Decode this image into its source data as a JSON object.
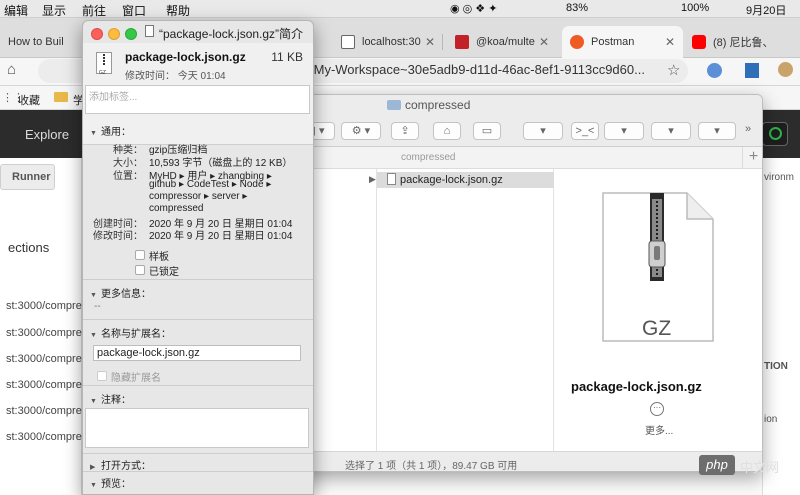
{
  "menubar": {
    "items": [
      "编辑",
      "显示",
      "前往",
      "窗口",
      "帮助"
    ],
    "status": {
      "battery_left": "83%",
      "battery_right": "100%",
      "date": "9月20日"
    }
  },
  "chrome": {
    "tabs": [
      {
        "label": "How to Buil"
      },
      {
        "label": "localhost:30"
      },
      {
        "label": "@koa/multe"
      },
      {
        "label": "Postman"
      },
      {
        "label": "(8) 尼比鲁、"
      }
    ],
    "url": "/My-Workspace~30e5adb9-d11d-46ac-8ef1-9113cc9d60...",
    "bookmarks": [
      "收藏",
      "学"
    ]
  },
  "postman": {
    "explore": "Explore",
    "runner": "Runner",
    "sections": "ections",
    "urls": [
      "st:3000/compres",
      "st:3000/compre",
      "st:3000/compre",
      "st:3000/compre",
      "st:3000/compre",
      "st:3000/compre"
    ],
    "right_labels": [
      "vironm",
      "TION",
      "ion"
    ]
  },
  "finder": {
    "title": "compressed",
    "path": "compressed",
    "selected_file": "package-lock.json.gz",
    "preview_icon_label": "GZ",
    "preview_name": "package-lock.json.gz",
    "more_label": "更多...",
    "status": "选择了 1 项（共 1 项），89.47 GB 可用"
  },
  "info": {
    "title": "“package-lock.json.gz”简介",
    "file_name": "package-lock.json.gz",
    "file_size": "11 KB",
    "icon_text": "GZ",
    "modified_line": "修改时间：  今天 01:04",
    "tags_placeholder": "添加标签...",
    "general": {
      "header": "通用：",
      "kind_label": "种类：",
      "kind": "gzip压缩归档",
      "size_label": "大小：",
      "size": "10,593 字节（磁盘上的 12 KB）",
      "where_label": "位置：",
      "where_lines": [
        "MyHD ▸ 用户 ▸ zhangbing ▸",
        "github ▸ CodeTest ▸ Node ▸",
        "compressor ▸ server ▸",
        "compressed"
      ],
      "created_label": "创建时间：",
      "created": "2020 年 9 月 20 日 星期日 01:04",
      "modified_label": "修改时间：",
      "modified": "2020 年 9 月 20 日 星期日 01:04",
      "stationery_label": "样板",
      "locked_label": "已锁定"
    },
    "more_info": {
      "header": "更多信息：",
      "value": "--"
    },
    "name_ext": {
      "header": "名称与扩展名：",
      "value": "package-lock.json.gz",
      "hide_ext_label": "隐藏扩展名"
    },
    "comments": {
      "header": "注释："
    },
    "open_with": {
      "header": "打开方式："
    },
    "preview": {
      "header": "预览："
    }
  },
  "watermark": {
    "logo": "php",
    "text": "中文网"
  }
}
